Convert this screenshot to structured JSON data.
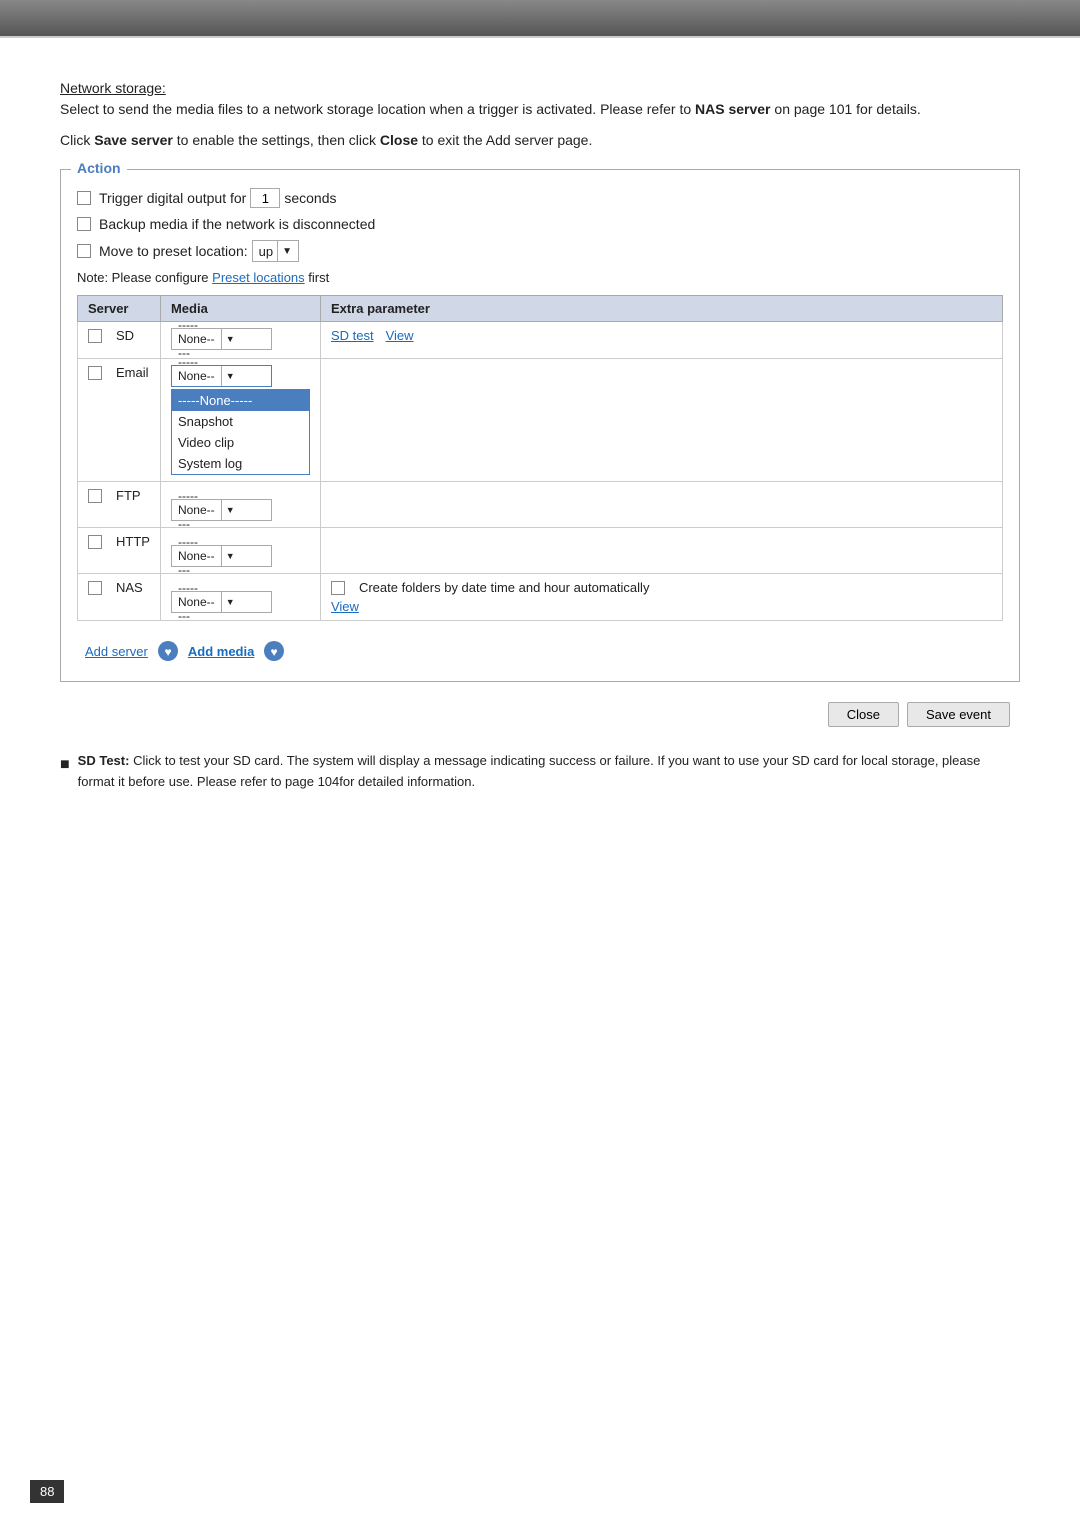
{
  "topbar": {},
  "content": {
    "network_storage_title": "Network storage:",
    "intro_p1": "Select to send the media files to a network storage location when a trigger is activated. Please refer to",
    "intro_bold": "NAS server",
    "intro_p2": "on page 101 for details.",
    "click_instruction_pre": "Click",
    "click_save_server": "Save server",
    "click_mid": "to enable the settings, then click",
    "click_close": "Close",
    "click_post": "to exit the Add server page.",
    "action": {
      "label": "Action",
      "trigger_label_pre": "Trigger digital output for",
      "trigger_value": "1",
      "trigger_label_post": "seconds",
      "backup_label": "Backup media if the network is disconnected",
      "preset_label": "Move to preset location:",
      "preset_value": "up",
      "note_pre": "Note: Please configure",
      "note_link": "Preset locations",
      "note_post": "first"
    },
    "table": {
      "headers": [
        "Server",
        "Media",
        "Extra parameter"
      ],
      "rows": [
        {
          "server": "SD",
          "media_select": "-----None-----",
          "media_dropdown": {
            "items": [
              "-----None-----",
              "Snapshot",
              "Video clip",
              "System log"
            ],
            "selected": 0
          },
          "extra": {
            "sd_test": "SD test",
            "view": "View"
          },
          "has_dropdown": true
        },
        {
          "server": "Email",
          "media_select": "-----None-----",
          "media_dropdown": null,
          "extra": {},
          "has_dropdown": false,
          "show_popup": true,
          "popup_items": [
            "-----None-----",
            "Snapshot",
            "Video clip",
            "System log"
          ]
        },
        {
          "server": "FTP",
          "media_select": "-----None-----",
          "media_dropdown": null,
          "extra": {},
          "has_dropdown": false
        },
        {
          "server": "HTTP",
          "media_select": "-----None-----",
          "media_dropdown": null,
          "extra": {},
          "has_dropdown": false
        },
        {
          "server": "NAS",
          "media_select": "-----None-----",
          "media_dropdown": null,
          "extra": {
            "create_folders": "Create folders by date time and hour automatically",
            "view": "View"
          },
          "has_dropdown": false
        }
      ]
    },
    "add_server_label": "Add server",
    "add_media_label": "Add media",
    "close_btn": "Close",
    "save_event_btn": "Save event",
    "bullet_note": {
      "icon": "■",
      "text_bold": "SD Test:",
      "text": "Click to test your SD card. The system will display a message indicating success or failure. If you want to use your SD card for local storage, please format it before use. Please refer to page 104for detailed information."
    },
    "page_number": "88"
  }
}
